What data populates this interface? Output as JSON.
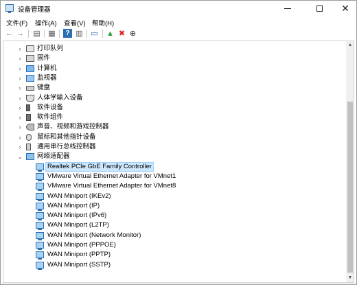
{
  "window": {
    "title": "设备管理器",
    "minimize_glyph": "—",
    "close_glyph": "✕"
  },
  "menu": {
    "items": [
      "文件(F)",
      "操作(A)",
      "查看(V)",
      "帮助(H)"
    ]
  },
  "toolbar": {
    "buttons": [
      {
        "icon": "back-icon",
        "glyph": "←"
      },
      {
        "icon": "forward-icon",
        "glyph": "→"
      },
      {
        "icon": "show-hide-console-tree-icon",
        "glyph": "▤"
      },
      {
        "icon": "properties-icon",
        "glyph": "▦"
      },
      {
        "icon": "help-icon",
        "glyph": "?"
      },
      {
        "icon": "view-icon",
        "glyph": "▥"
      },
      {
        "icon": "scan-hardware-icon",
        "glyph": "▭"
      },
      {
        "icon": "update-driver-icon",
        "glyph": "▲"
      },
      {
        "icon": "uninstall-icon",
        "glyph": "✖"
      },
      {
        "icon": "disable-icon",
        "glyph": "⊕"
      }
    ]
  },
  "tree": {
    "categories": [
      {
        "label": "打印队列",
        "icon": "printer-icon",
        "expanded": false
      },
      {
        "label": "固件",
        "icon": "firmware-icon",
        "expanded": false
      },
      {
        "label": "计算机",
        "icon": "computer-icon",
        "expanded": false
      },
      {
        "label": "监视器",
        "icon": "monitor-icon",
        "expanded": false
      },
      {
        "label": "键盘",
        "icon": "keyboard-icon",
        "expanded": false
      },
      {
        "label": "人体学输入设备",
        "icon": "hid-icon",
        "expanded": false
      },
      {
        "label": "软件设备",
        "icon": "software-device-icon",
        "expanded": false
      },
      {
        "label": "软件组件",
        "icon": "software-component-icon",
        "expanded": false
      },
      {
        "label": "声音、视频和游戏控制器",
        "icon": "sound-icon",
        "expanded": false
      },
      {
        "label": "鼠标和其他指针设备",
        "icon": "mouse-icon",
        "expanded": false
      },
      {
        "label": "通用串行总线控制器",
        "icon": "usb-icon",
        "expanded": false
      },
      {
        "label": "网络适配器",
        "icon": "network-adapter-icon",
        "expanded": true
      }
    ],
    "network_adapters": [
      {
        "label": "Realtek PCIe GbE Family Controller",
        "selected": true
      },
      {
        "label": "VMware Virtual Ethernet Adapter for VMnet1",
        "selected": false
      },
      {
        "label": "VMware Virtual Ethernet Adapter for VMnet8",
        "selected": false
      },
      {
        "label": "WAN Miniport (IKEv2)",
        "selected": false
      },
      {
        "label": "WAN Miniport (IP)",
        "selected": false
      },
      {
        "label": "WAN Miniport (IPv6)",
        "selected": false
      },
      {
        "label": "WAN Miniport (L2TP)",
        "selected": false
      },
      {
        "label": "WAN Miniport (Network Monitor)",
        "selected": false
      },
      {
        "label": "WAN Miniport (PPPOE)",
        "selected": false
      },
      {
        "label": "WAN Miniport (PPTP)",
        "selected": false
      },
      {
        "label": "WAN Miniport (SSTP)",
        "selected": false
      }
    ]
  },
  "colors": {
    "selection_bg": "#cce8ff",
    "selection_border": "#99d1ff",
    "uninstall_red": "#d81e1e",
    "update_green": "#2a9d3a"
  }
}
